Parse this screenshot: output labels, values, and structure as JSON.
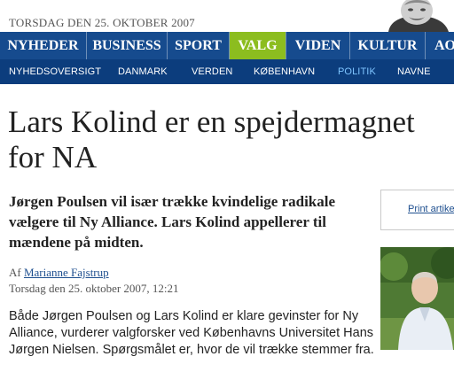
{
  "header": {
    "date": "TORSDAG DEN 25. OKTOBER 2007",
    "portrait_icon": "columnist-portrait"
  },
  "nav": {
    "items": [
      {
        "label": "NYHEDER",
        "active": false
      },
      {
        "label": "BUSINESS",
        "active": false
      },
      {
        "label": "SPORT",
        "active": false
      },
      {
        "label": "VALG",
        "active": true
      },
      {
        "label": "VIDEN",
        "active": false
      },
      {
        "label": "KULTUR",
        "active": false
      },
      {
        "label": "AO",
        "active": false
      }
    ]
  },
  "subnav": {
    "items": [
      {
        "label": "NYHEDSOVERSIGT",
        "active": false
      },
      {
        "label": "DANMARK",
        "active": false
      },
      {
        "label": "VERDEN",
        "active": false
      },
      {
        "label": "KØBENHAVN",
        "active": false
      },
      {
        "label": "POLITIK",
        "active": true
      },
      {
        "label": "NAVNE",
        "active": false
      }
    ]
  },
  "article": {
    "title": "Lars Kolind er en spejdermagnet for NA",
    "lead": "Jørgen Poulsen vil især trække kvindelige radikale vælgere til Ny Alliance. Lars Kolind appellerer til mændene på midten.",
    "byline_prefix": "Af",
    "author": "Marianne Fajstrup",
    "published": "Torsdag den 25. oktober 2007, 12:21",
    "body": "Både Jørgen Poulsen og Lars Kolind er klare gevinster for Ny Alliance, vurderer valgforsker ved Københavns Universitet Hans Jørgen Nielsen. Spørgsmålet er, hvor de vil trække stemmer fra."
  },
  "sidebar": {
    "print_label": "Print artikel",
    "photo_icon": "article-photo"
  },
  "colors": {
    "nav_bg": "#164b8e",
    "subnav_bg": "#0c3d7d",
    "active_tab": "#8cbd1f",
    "link": "#1e4f8f"
  }
}
